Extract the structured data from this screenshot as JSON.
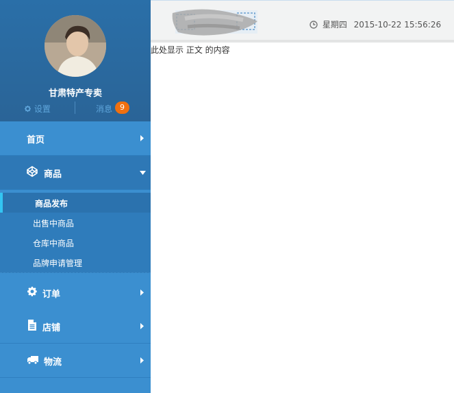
{
  "profile": {
    "shop_name": "甘肃特产专卖",
    "settings_label": "设置",
    "messages_label": "消息",
    "messages_count": "9"
  },
  "nav": {
    "home": "首页",
    "goods": "商品",
    "goods_sub": [
      "商品发布",
      "出售中商品",
      "仓库中商品",
      "品牌申请管理"
    ],
    "orders": "订单",
    "store": "店铺",
    "logistics": "物流"
  },
  "header": {
    "weekday": "星期四",
    "datetime": "2015-10-22 15:56:26"
  },
  "content": {
    "text": "此处显示 正文 的内容"
  },
  "colors": {
    "sidebar": "#3b8fd0",
    "profile_bg": "#2a6497",
    "badge": "#f07010",
    "active_bar": "#33c5f3"
  }
}
